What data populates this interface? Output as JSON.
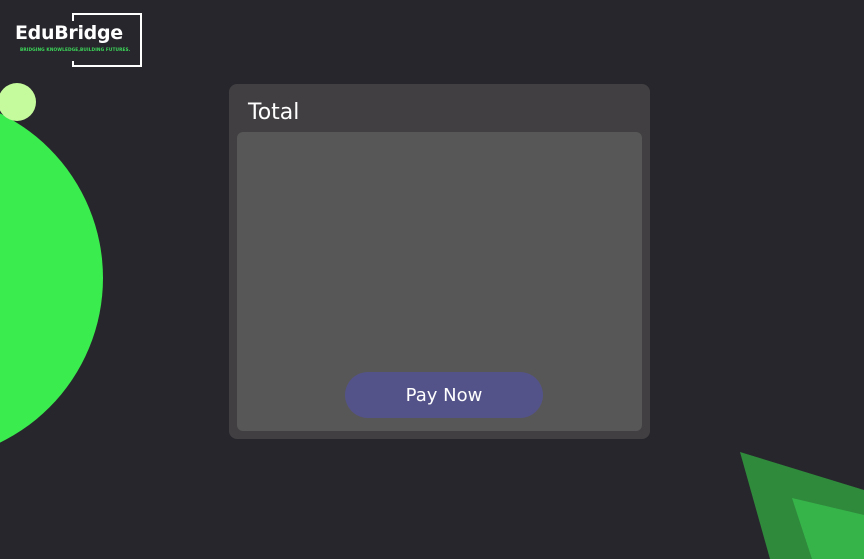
{
  "brand": {
    "name": "EduBridge",
    "tagline": "BRIDGING KNOWLEDGE,BUILDING FUTURES."
  },
  "card": {
    "title": "Total",
    "pay_button_label": "Pay Now"
  },
  "colors": {
    "background": "#27262c",
    "card": "#413f41",
    "card_body": "#575757",
    "button": "#545389",
    "accent_green": "#3bec4e",
    "accent_light_green": "#c5fb9c",
    "tagline_green": "#3cd85a",
    "triangle_dark_green": "#2f8a3b",
    "triangle_mid_green": "#36b44a"
  }
}
